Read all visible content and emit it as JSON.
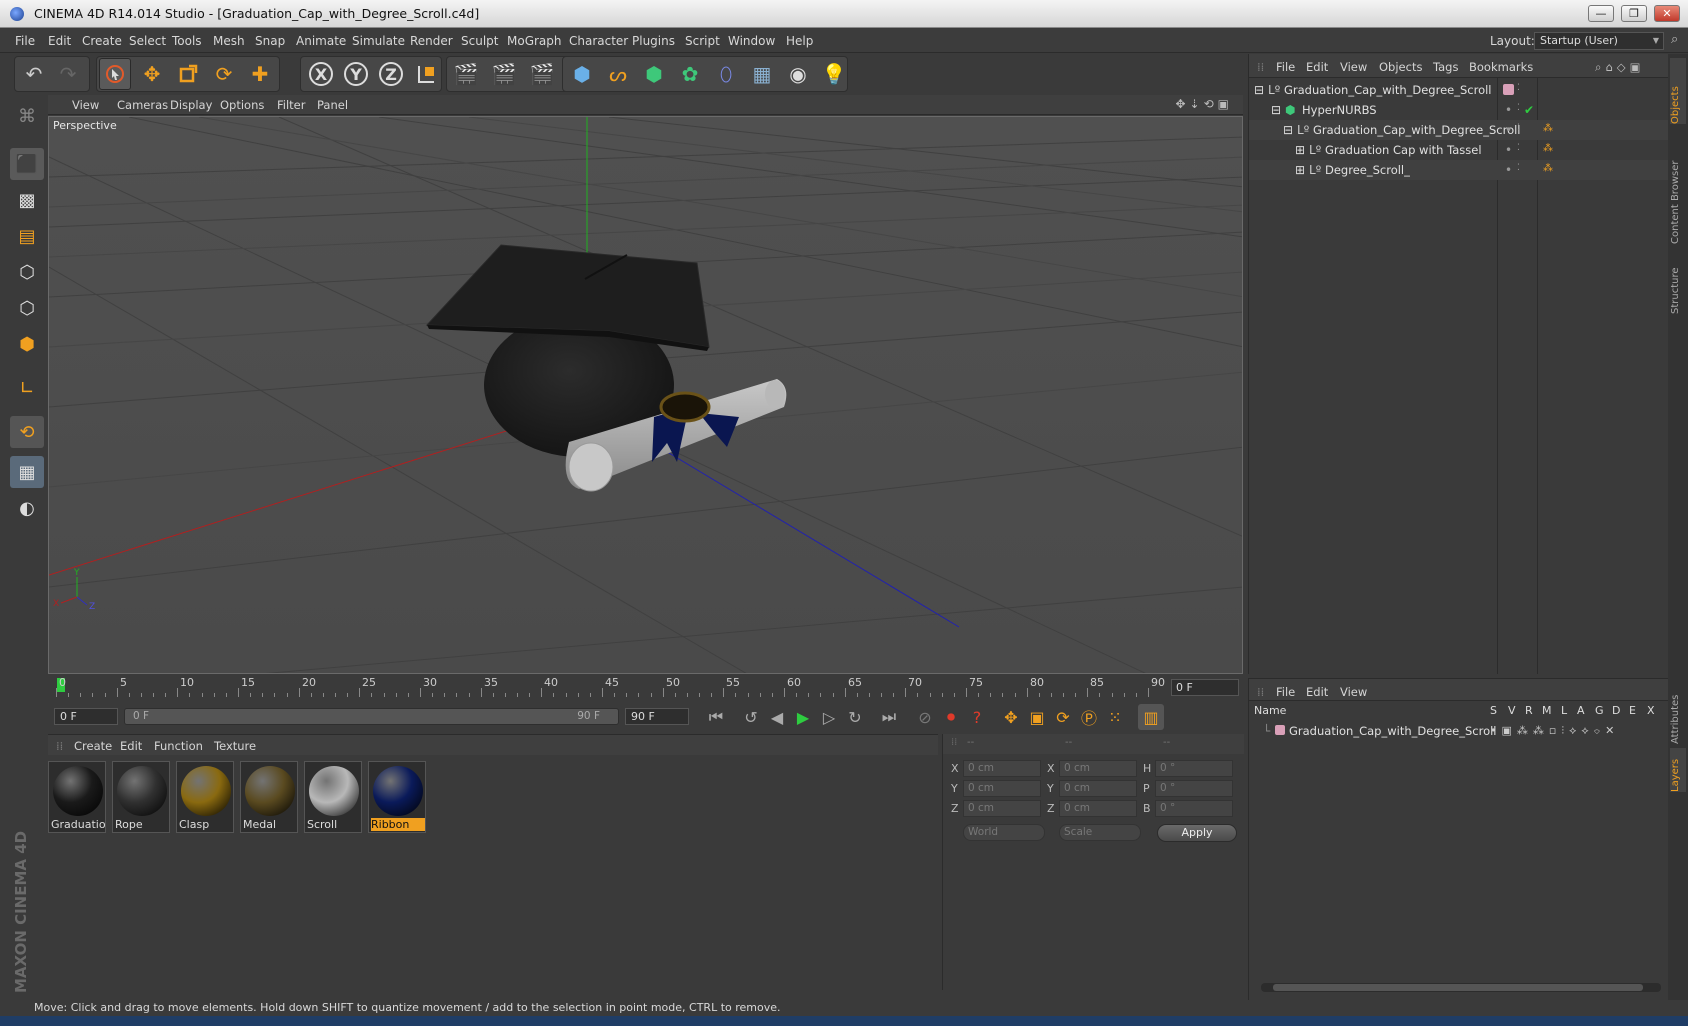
{
  "window": {
    "title": "CINEMA 4D R14.014 Studio - [Graduation_Cap_with_Degree_Scroll.c4d]"
  },
  "menu": [
    "File",
    "Edit",
    "Create",
    "Select",
    "Tools",
    "Mesh",
    "Snap",
    "Animate",
    "Simulate",
    "Render",
    "Sculpt",
    "MoGraph",
    "Character",
    "Plugins",
    "Script",
    "Window",
    "Help"
  ],
  "layout": {
    "label": "Layout:",
    "value": "Startup (User)"
  },
  "viewport": {
    "menu": [
      "View",
      "Cameras",
      "Display",
      "Options",
      "Filter",
      "Panel"
    ],
    "camera_label": "Perspective",
    "axis_labels": {
      "x": "X",
      "y": "Y",
      "z": "Z"
    }
  },
  "timeline": {
    "ticks": [
      "0",
      "5",
      "10",
      "15",
      "20",
      "25",
      "30",
      "35",
      "40",
      "45",
      "50",
      "55",
      "60",
      "65",
      "70",
      "75",
      "80",
      "85",
      "90"
    ],
    "current_frame": "0 F",
    "start_field": "0 F",
    "range_start": "0 F",
    "range_end": "90 F",
    "end_field": "90 F"
  },
  "materials": {
    "menu": [
      "Create",
      "Edit",
      "Function",
      "Texture"
    ],
    "items": [
      {
        "label": "Graduation",
        "color": "#1a1a1a"
      },
      {
        "label": "Rope",
        "color": "#303030"
      },
      {
        "label": "Clasp",
        "color": "#8a6a10"
      },
      {
        "label": "Medal",
        "color": "#5a4a20"
      },
      {
        "label": "Scroll",
        "color": "#b8b8b8"
      },
      {
        "label": "Ribbon",
        "color": "#0a1a5a",
        "selected": true
      }
    ]
  },
  "coordinates": {
    "header": [
      "--",
      "--",
      "--"
    ],
    "rows": [
      {
        "l1": "X",
        "v1": "0 cm",
        "l2": "X",
        "v2": "0 cm",
        "l3": "H",
        "v3": "0 °"
      },
      {
        "l1": "Y",
        "v1": "0 cm",
        "l2": "Y",
        "v2": "0 cm",
        "l3": "P",
        "v3": "0 °"
      },
      {
        "l1": "Z",
        "v1": "0 cm",
        "l2": "Z",
        "v2": "0 cm",
        "l3": "B",
        "v3": "0 °"
      }
    ],
    "mode": "World",
    "scale": "Scale",
    "apply": "Apply"
  },
  "objects": {
    "menu": [
      "File",
      "Edit",
      "View",
      "Objects",
      "Tags",
      "Bookmarks"
    ],
    "tree": [
      {
        "name": "Graduation_Cap_with_Degree_Scroll"
      },
      {
        "name": "HyperNURBS"
      },
      {
        "name": "Graduation_Cap_with_Degree_Scroll"
      },
      {
        "name": "Graduation Cap with Tassel"
      },
      {
        "name": "Degree_Scroll_"
      }
    ]
  },
  "layers": {
    "menu": [
      "File",
      "Edit",
      "View"
    ],
    "columns": [
      "Name",
      "S",
      "V",
      "R",
      "M",
      "L",
      "A",
      "G",
      "D",
      "E",
      "X"
    ],
    "rows": [
      {
        "name": "Graduation_Cap_with_Degree_Scroll"
      }
    ]
  },
  "side_tabs": [
    "Objects",
    "Content Browser",
    "Structure",
    "Attributes",
    "Layers"
  ],
  "status": "Move: Click and drag to move elements. Hold down SHIFT to quantize movement / add to the selection in point mode, CTRL to remove.",
  "brand": "MAXON CINEMA 4D"
}
